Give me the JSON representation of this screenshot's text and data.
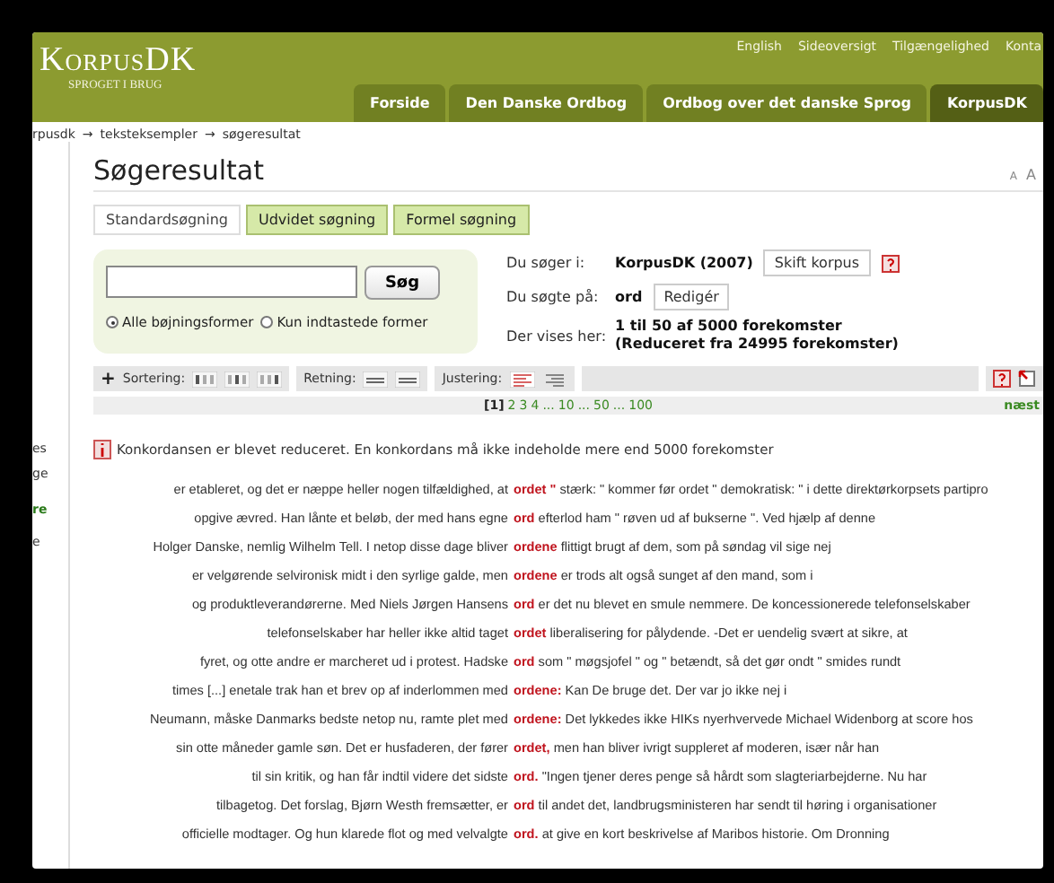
{
  "header": {
    "logo": "KorpusDK",
    "tagline": "SPROGET I BRUG",
    "top_links": [
      "English",
      "Sideoversigt",
      "Tilgængelighed",
      "Konta"
    ],
    "tabs": [
      {
        "label": "Forside",
        "selected": false
      },
      {
        "label": "Den Danske Ordbog",
        "selected": false
      },
      {
        "label": "Ordbog over det danske Sprog",
        "selected": false
      },
      {
        "label": "KorpusDK",
        "selected": true
      }
    ]
  },
  "breadcrumb": [
    {
      "label": "rpusdk",
      "arrow": "→"
    },
    {
      "label": "teksteksempler",
      "arrow": "→"
    },
    {
      "label": "søgeresultat"
    }
  ],
  "sidebar": [
    "es",
    "ge",
    "re",
    "e"
  ],
  "title": "Søgeresultat",
  "font_sizes": [
    "A",
    "A"
  ],
  "search_tabs": [
    {
      "label": "Standardsøgning",
      "selected": true
    },
    {
      "label": "Udvidet søgning",
      "selected": false
    },
    {
      "label": "Formel søgning",
      "selected": false
    }
  ],
  "search": {
    "button": "Søg",
    "options": [
      {
        "label": "Alle bøjningsformer",
        "selected": true
      },
      {
        "label": "Kun indtastede former",
        "selected": false
      }
    ]
  },
  "info": {
    "corpus_label": "Du søger i:",
    "corpus": "KorpusDK (2007)",
    "switch_button": "Skift korpus",
    "query_label": "Du søgte på:",
    "query": "ord",
    "edit_button": "Redigér",
    "shown_label": "Der vises her:",
    "shown": "1 til 50 af 5000 forekomster",
    "reduced": "(Reduceret fra 24995 forekomster)"
  },
  "toolbar": {
    "add": "+",
    "sort_label": "Sortering:",
    "direction_label": "Retning:",
    "align_label": "Justering:"
  },
  "pagination": {
    "pages": [
      {
        "label": "[1]",
        "selected": true
      },
      {
        "label": "2",
        "selected": false
      },
      {
        "label": "3",
        "selected": false
      },
      {
        "label": "4",
        "selected": false
      },
      {
        "label": "...",
        "selected": false
      },
      {
        "label": "10",
        "selected": false
      },
      {
        "label": "...",
        "selected": false
      },
      {
        "label": "50",
        "selected": false
      },
      {
        "label": "...",
        "selected": false
      },
      {
        "label": "100",
        "selected": false
      }
    ],
    "next": "næst"
  },
  "notice": "Konkordansen er blevet reduceret. En konkordans må ikke indeholde mere end 5000 forekomster",
  "concordance": [
    {
      "left": "er etableret, og det er næppe heller nogen tilfældighed, at",
      "keyword": "ordet \"",
      "right": "stærk: \" kommer før ordet \" demokratisk: \" i dette direktørkorpsets partipro"
    },
    {
      "left": "opgive ævred. Han lånte et beløb, der med hans egne",
      "keyword": "ord",
      "right": "efterlod ham \" røven ud af bukserne \". Ved hjælp af denne"
    },
    {
      "left": "Holger Danske, nemlig Wilhelm Tell. I netop disse dage bliver",
      "keyword": "ordene",
      "right": "flittigt brugt af dem, som på søndag vil sige nej"
    },
    {
      "left": "er velgørende selvironisk midt i den syrlige galde, men",
      "keyword": "ordene",
      "right": "er trods alt også sunget af den mand, som i"
    },
    {
      "left": "og produktleverandørerne. Med Niels Jørgen Hansens",
      "keyword": "ord",
      "right": "er det nu blevet en smule nemmere. De koncessionerede telefonselskaber"
    },
    {
      "left": "telefonselskaber har heller ikke altid taget",
      "keyword": "ordet",
      "right": "liberalisering for pålydende. -Det er uendelig svært at sikre, at"
    },
    {
      "left": "fyret, og otte andre er marcheret ud i protest. Hadske",
      "keyword": "ord",
      "right": "som \" møgsjofel \" og \" betændt, så det gør ondt \" smides rundt"
    },
    {
      "left": "times [...] enetale trak han et brev op af inderlommen med",
      "keyword": "ordene:",
      "right": "Kan De bruge det. Der var jo ikke nej i"
    },
    {
      "left": "Neumann, måske Danmarks bedste netop nu, ramte plet med",
      "keyword": "ordene:",
      "right": "Det lykkedes ikke HIKs nyerhvervede Michael Widenborg at score hos"
    },
    {
      "left": "sin otte måneder gamle søn. Det er husfaderen, der fører",
      "keyword": "ordet,",
      "right": "men han bliver ivrigt suppleret af moderen, især når han"
    },
    {
      "left": "til sin kritik, og han får indtil videre det sidste",
      "keyword": "ord.",
      "right": "\"Ingen tjener deres penge så hårdt som slagteriarbejderne. Nu har"
    },
    {
      "left": "tilbagetog. Det forslag, Bjørn Westh fremsætter, er",
      "keyword": "ord",
      "right": "til andet det, landbrugsministeren har sendt til høring i organisationer"
    },
    {
      "left": "officielle modtager. Og hun klarede flot og med velvalgte",
      "keyword": "ord.",
      "right": "at give en kort beskrivelse af Maribos historie. Om Dronning"
    }
  ]
}
